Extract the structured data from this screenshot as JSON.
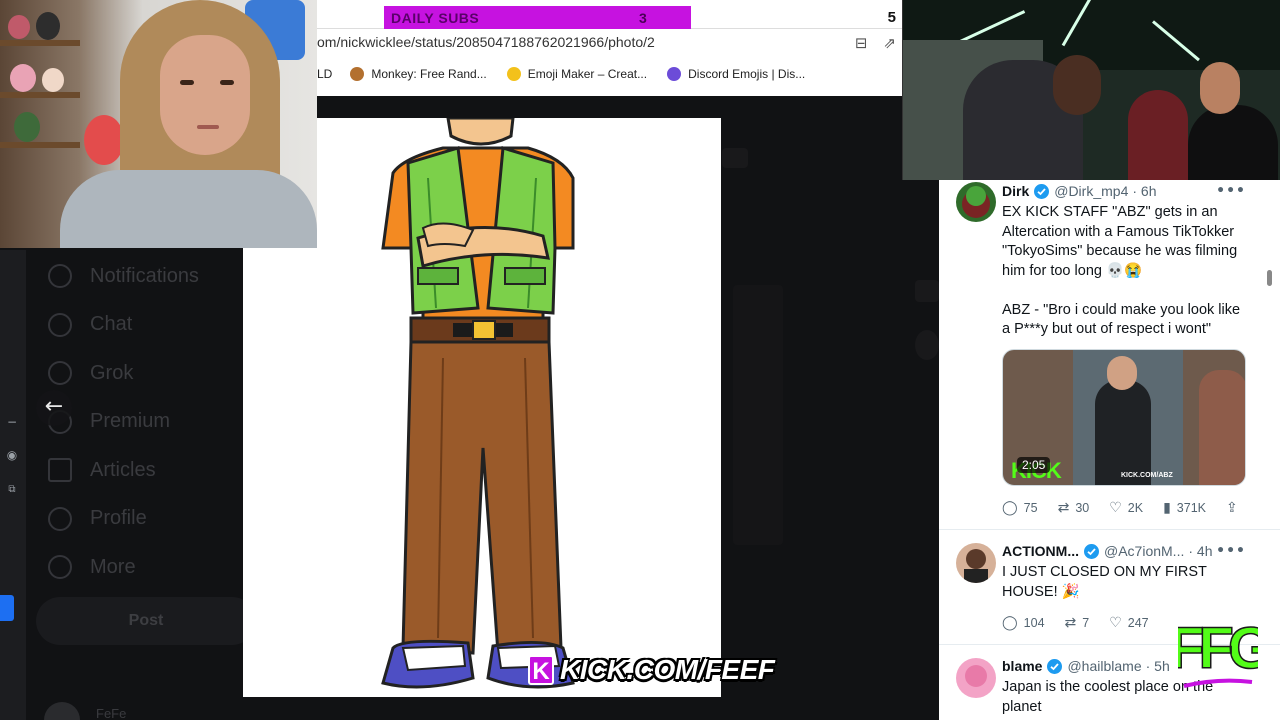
{
  "browser": {
    "subs_label": "DAILY SUBS",
    "subs_current": "3",
    "subs_goal": "5",
    "subs_progress": 0.6,
    "url": "om/nickwicklee/status/2085047188762021966/photo/2",
    "bookmarks": [
      {
        "label": "LD",
        "icon": "none"
      },
      {
        "label": "Monkey: Free Rand...",
        "icon": "monkey-icon"
      },
      {
        "label": "Emoji Maker – Creat...",
        "icon": "emoji-icon"
      },
      {
        "label": "Discord Emojis | Dis...",
        "icon": "discord-icon"
      }
    ]
  },
  "x_sidebar": {
    "nav_items": [
      "Notifications",
      "Chat",
      "Grok",
      "Premium",
      "Articles",
      "Profile",
      "More"
    ],
    "post_label": "Post",
    "profile_name": "FeFe"
  },
  "overlay": {
    "kick_url": "KICK.COM/FEEF",
    "kick_badge": "K",
    "ffg_logo": "FFG"
  },
  "feed": {
    "tweets": [
      {
        "name": "Dirk",
        "handle": "@Dirk_mp4",
        "time": "· 6h",
        "text_lines": [
          "EX KICK STAFF \"ABZ\" gets in an",
          "Altercation with a Famous TikTokker",
          "\"TokyoSims\" because he was filming",
          "him for too long 💀😭",
          "",
          "ABZ - \"Bro i could make you look like",
          "a P***y but out of respect i wont\""
        ],
        "media_duration": "2:05",
        "media_logo": "KICK",
        "media_url": "KICK.COM/ABZ",
        "replies": "75",
        "reposts": "30",
        "likes": "2K",
        "views": "371K"
      },
      {
        "name": "ACTIONM...",
        "handle": "@Ac7ionM...",
        "time": "· 4h",
        "text_lines": [
          "I JUST CLOSED ON MY FIRST",
          "HOUSE! 🎉"
        ],
        "replies": "104",
        "reposts": "7",
        "likes": "247"
      },
      {
        "name": "blame",
        "handle": "@hailblame",
        "time": "· 5h",
        "text_lines": [
          "Japan is the coolest place on the",
          "planet"
        ]
      }
    ]
  },
  "colors": {
    "kick_purple": "#c612e0",
    "kick_green": "#53fc18",
    "twitter_blue": "#1d9bf0"
  }
}
